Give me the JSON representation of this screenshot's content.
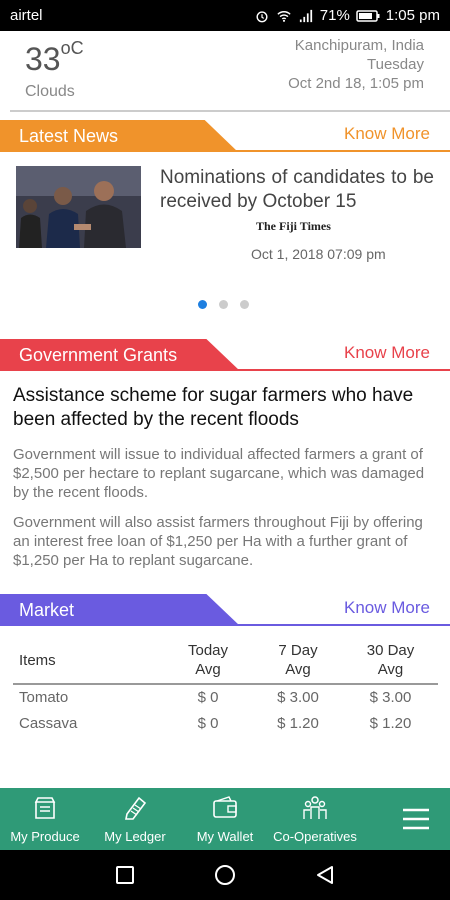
{
  "status_bar": {
    "carrier": "airtel",
    "battery": "71%",
    "time": "1:05 pm"
  },
  "weather": {
    "temp": "33",
    "unit": "oC",
    "condition": "Clouds",
    "location": "Kanchipuram, India",
    "day": "Tuesday",
    "datetime": "Oct 2nd 18, 1:05 pm"
  },
  "news": {
    "header": "Latest News",
    "more": "Know More",
    "title": "Nominations of candidates to be received by October 15",
    "source": "The Fiji Times",
    "date": "Oct 1, 2018 07:09 pm",
    "carousel_pages": 3,
    "carousel_active": 1,
    "color": "#f0932b"
  },
  "grants": {
    "header": "Government Grants",
    "more": "Know More",
    "title": "Assistance scheme for sugar farmers who have been affected by the recent floods",
    "p1": "Government will issue to individual affected farmers a grant of $2,500 per hectare to replant sugarcane, which was damaged by the recent floods.",
    "p2": "Government will also assist farmers throughout Fiji by offering an interest free loan of $1,250 per Ha with a further grant of $1,250 per Ha to replant sugarcane.",
    "color": "#e8424b"
  },
  "market": {
    "header": "Market",
    "more": "Know More",
    "columns": [
      "Items",
      "Today Avg",
      "7 Day Avg",
      "30 Day Avg"
    ],
    "col_today_l1": "Today",
    "col_today_l2": "Avg",
    "col_7_l1": "7 Day",
    "col_7_l2": "Avg",
    "col_30_l1": "30 Day",
    "col_30_l2": "Avg",
    "rows": [
      {
        "name": "Tomato",
        "today": "$ 0",
        "d7": "$ 3.00",
        "d30": "$ 3.00"
      },
      {
        "name": "Cassava",
        "today": "$ 0",
        "d7": "$ 1.20",
        "d30": "$ 1.20"
      }
    ],
    "color": "#6a5be0"
  },
  "bottom_nav": {
    "items": [
      {
        "label": "My Produce",
        "icon": "produce-icon"
      },
      {
        "label": "My Ledger",
        "icon": "ledger-icon"
      },
      {
        "label": "My Wallet",
        "icon": "wallet-icon"
      },
      {
        "label": "Co-Operatives",
        "icon": "cooperatives-icon"
      }
    ],
    "menu_icon": "menu-icon",
    "color": "#2f9a77"
  }
}
